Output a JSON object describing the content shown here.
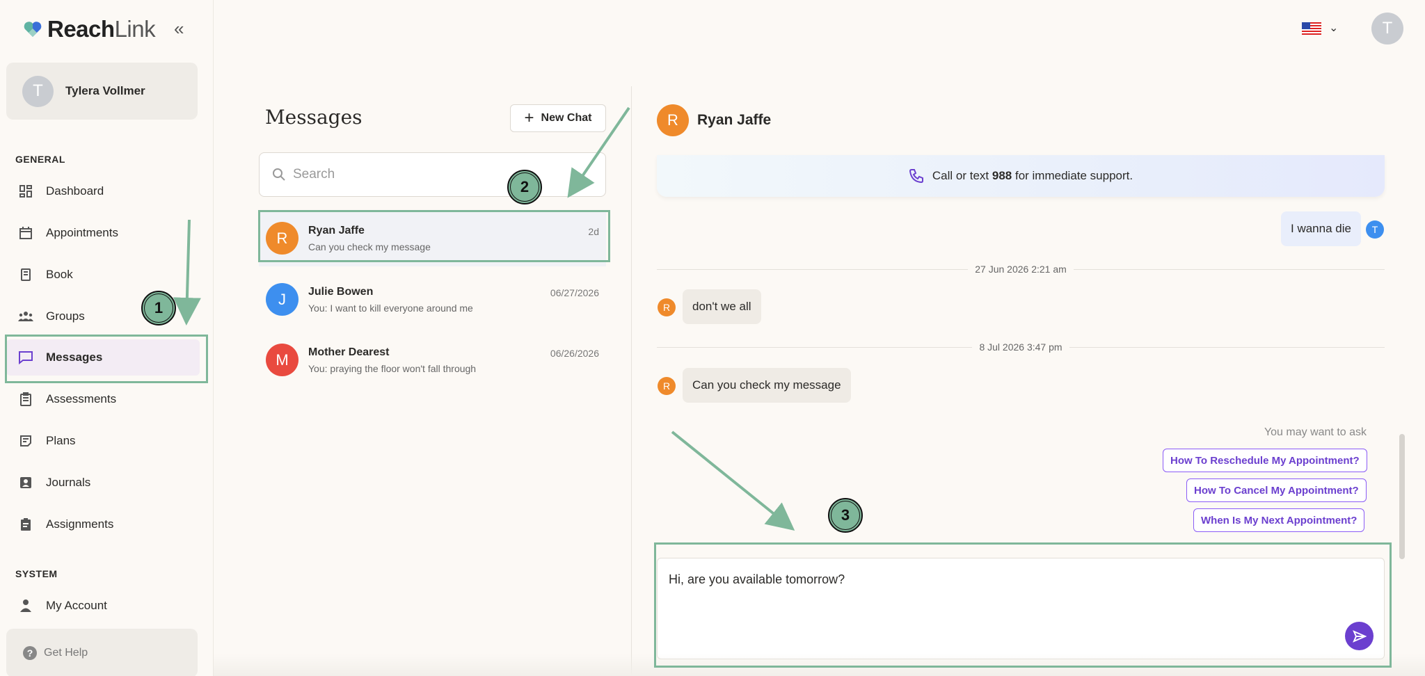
{
  "app": {
    "logo_bold": "Reach",
    "logo_light": "Link"
  },
  "user": {
    "initial": "T",
    "name": "Tylera Vollmer"
  },
  "sidebar": {
    "general_label": "GENERAL",
    "system_label": "SYSTEM",
    "items": [
      {
        "label": "Dashboard",
        "icon": "dashboard-icon"
      },
      {
        "label": "Appointments",
        "icon": "calendar-icon"
      },
      {
        "label": "Book",
        "icon": "book-icon"
      },
      {
        "label": "Groups",
        "icon": "groups-icon"
      },
      {
        "label": "Messages",
        "icon": "chat-icon",
        "active": true
      },
      {
        "label": "Assessments",
        "icon": "clipboard-icon"
      },
      {
        "label": "Plans",
        "icon": "plans-icon"
      },
      {
        "label": "Journals",
        "icon": "journal-icon"
      },
      {
        "label": "Assignments",
        "icon": "assignment-icon"
      }
    ],
    "system_items": [
      {
        "label": "My Account",
        "icon": "person-icon"
      }
    ],
    "help": "Get Help"
  },
  "header": {
    "avatar_initial": "T",
    "language": "us-flag"
  },
  "messages": {
    "title": "Messages",
    "new_chat": "New Chat",
    "search_placeholder": "Search",
    "chats": [
      {
        "initial": "R",
        "name": "Ryan Jaffe",
        "preview": "Can you check my message",
        "time": "2d",
        "color": "#ef8a2b",
        "selected": true
      },
      {
        "initial": "J",
        "name": "Julie Bowen",
        "preview": "You: I want to kill everyone around me",
        "time": "06/27/2026",
        "color": "#3d8fef"
      },
      {
        "initial": "M",
        "name": "Mother Dearest",
        "preview": "You: praying the floor won't fall through",
        "time": "06/26/2026",
        "color": "#e94a3f"
      }
    ]
  },
  "conversation": {
    "contact_initial": "R",
    "contact_name": "Ryan Jaffe",
    "banner_pre": "Call or text ",
    "banner_number": "988",
    "banner_post": " for immediate support.",
    "msg_me_1": "I wanna die",
    "me_initial": "T",
    "date_1": "27 Jun 2026 2:21 am",
    "msg_them_1": "don't we all",
    "date_2": "8 Jul 2026 3:47 pm",
    "msg_them_2": "Can you check my message",
    "them_initial": "R",
    "suggest_label": "You may want to ask",
    "suggestions": [
      "How To Reschedule My Appointment?",
      "How To Cancel My Appointment?",
      "When Is My Next Appointment?"
    ],
    "draft": "Hi, are you available tomorrow?"
  },
  "annotations": {
    "step1": "1",
    "step2": "2",
    "step3": "3"
  },
  "colors": {
    "accent": "#6b3fcf",
    "annotation": "#7fb79a"
  }
}
